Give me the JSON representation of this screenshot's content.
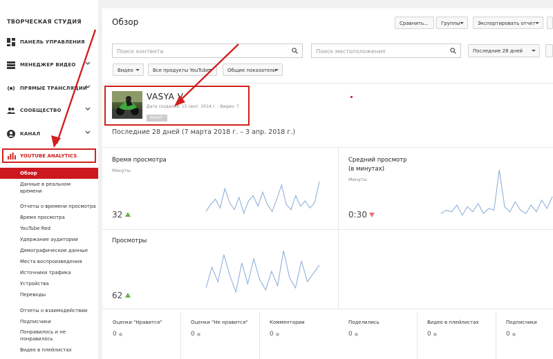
{
  "sidebar": {
    "studio_title": "ТВОРЧЕСКАЯ СТУДИЯ",
    "items": [
      {
        "label": "ПАНЕЛЬ УПРАВЛЕНИЯ",
        "icon": "dashboard-icon"
      },
      {
        "label": "МЕНЕДЖЕР ВИДЕО",
        "icon": "video-manager-icon"
      },
      {
        "label": "ПРЯМЫЕ ТРАНСЛЯЦИИ",
        "icon": "live-icon"
      },
      {
        "label": "СООБЩЕСТВО",
        "icon": "community-icon"
      },
      {
        "label": "КАНАЛ",
        "icon": "channel-icon"
      }
    ],
    "analytics_label": "YOUTUBE ANALYTICS",
    "active_sub": "Обзор",
    "subitems": [
      "Данные в реальном",
      "времени",
      "Отчеты о времени просмотра",
      "Время просмотра",
      "YouTube Red",
      "Удержание аудитории",
      "Демографические данные",
      "Места воспроизведения",
      "Источники трафика",
      "Устройства",
      "Переводы",
      "Отчеты о взаимодействии",
      "Подписчики",
      "Понравилось и не",
      "понравилось",
      "Видео в плейлистах"
    ]
  },
  "header": {
    "title": "Обзор",
    "compare_label": "Сравнить...",
    "groups_label": "Группы",
    "export_label": "Экспортировать отчет"
  },
  "filters": {
    "content_search_placeholder": "Поиск контента",
    "location_search_placeholder": "Поиск местоположения",
    "period_label": "Последние 28 дней",
    "video_label": "Видео",
    "products_label": "Все продукты YouTube",
    "metrics_label": "Общие показатели"
  },
  "channel": {
    "name": "VASYA V",
    "meta": "Дата создания: 15 сент. 2014 г. · Видео: 7",
    "badge": "КАНАЛ"
  },
  "period_text": "Последние 28 дней (7 марта 2018 г. – 3 апр. 2018 г.)",
  "cards": {
    "watch_time": {
      "title": "Время просмотра",
      "subtitle": "Минуты",
      "value": "32"
    },
    "avg_view": {
      "title": "Средний просмотр",
      "title2": "(в минутах)",
      "subtitle": "Минуты",
      "value": "0:30"
    },
    "views": {
      "title": "Просмотры",
      "value": "62"
    }
  },
  "stats": [
    {
      "label": "Оценки \"Нравится\"",
      "value": "0"
    },
    {
      "label": "Оценки \"Не нравится\"",
      "value": "0"
    },
    {
      "label": "Комментарии",
      "value": "0"
    },
    {
      "label": "Поделились",
      "value": "0"
    },
    {
      "label": "Видео в плейлистах",
      "value": "0"
    },
    {
      "label": "Подписчики",
      "value": "0"
    }
  ],
  "colors": {
    "accent": "#cc181e",
    "annotation": "#d0201e",
    "spark": "#8fb0d9",
    "up": "#6ab04c",
    "down": "#e57373"
  },
  "chart_data": [
    {
      "type": "line",
      "name": "watch_time",
      "values": [
        5,
        9,
        12,
        7,
        18,
        10,
        6,
        13,
        4,
        11,
        14,
        8,
        16,
        9,
        5,
        12,
        20,
        9,
        6,
        14,
        8,
        11,
        7,
        10,
        22
      ]
    },
    {
      "type": "line",
      "name": "avg_view",
      "values": [
        4,
        6,
        5,
        9,
        3,
        8,
        5,
        10,
        4,
        7,
        6,
        30,
        8,
        5,
        11,
        6,
        4,
        9,
        5,
        12,
        7,
        14
      ]
    },
    {
      "type": "line",
      "name": "views",
      "values": [
        6,
        16,
        9,
        22,
        12,
        4,
        18,
        8,
        20,
        10,
        5,
        14,
        7,
        24,
        11,
        6,
        19,
        9,
        13,
        17
      ]
    }
  ]
}
